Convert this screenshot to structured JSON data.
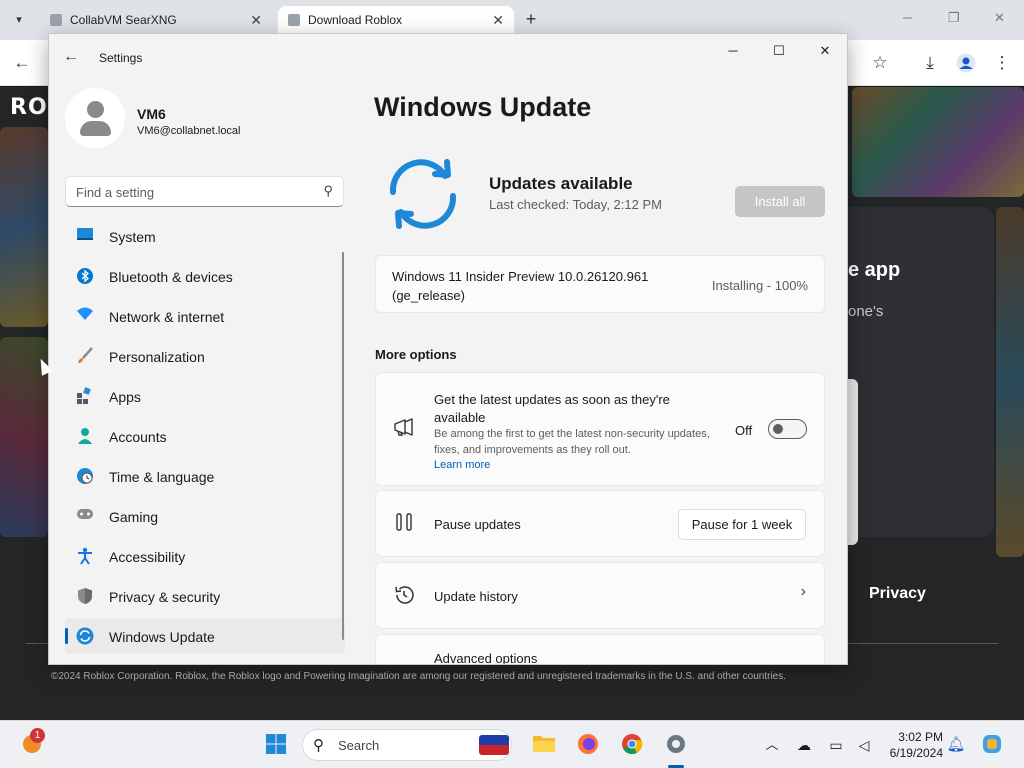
{
  "browser": {
    "tabs": [
      {
        "label": "CollabVM SearXNG"
      },
      {
        "label": "Download Roblox"
      }
    ],
    "close_glyph": "✕",
    "new_tab_glyph": "+"
  },
  "roblox_page": {
    "logo": "RO",
    "heading_fragment": "e app",
    "sub_fragment": "one's",
    "privacy_link": "Privacy",
    "footer": "©2024 Roblox Corporation. Roblox, the Roblox logo and Powering Imagination are among our registered and unregistered trademarks in the U.S. and other countries."
  },
  "settings": {
    "app_title": "Settings",
    "account": {
      "name": "VM6",
      "email": "VM6@collabnet.local"
    },
    "search": {
      "placeholder": "Find a setting"
    },
    "nav": [
      {
        "label": "System",
        "icon": "system-icon",
        "color": "#0078d4"
      },
      {
        "label": "Bluetooth & devices",
        "icon": "bluetooth-icon",
        "color": "#0078d4"
      },
      {
        "label": "Network & internet",
        "icon": "wifi-icon",
        "color": "#0a84ff"
      },
      {
        "label": "Personalization",
        "icon": "brush-icon",
        "color": "#d35400"
      },
      {
        "label": "Apps",
        "icon": "apps-icon",
        "color": "#4a6f8f"
      },
      {
        "label": "Accounts",
        "icon": "accounts-icon",
        "color": "#0f9d8a"
      },
      {
        "label": "Time & language",
        "icon": "globe-clock-icon",
        "color": "#0078d4"
      },
      {
        "label": "Gaming",
        "icon": "gamepad-icon",
        "color": "#6b6b6b"
      },
      {
        "label": "Accessibility",
        "icon": "accessibility-icon",
        "color": "#1a73e8"
      },
      {
        "label": "Privacy & security",
        "icon": "shield-icon",
        "color": "#6b6b6b"
      },
      {
        "label": "Windows Update",
        "icon": "windows-update-icon",
        "color": "#0a6ed1",
        "active": true
      }
    ],
    "main": {
      "title": "Windows Update",
      "status": "Updates available",
      "last_checked": "Last checked: Today, 2:12 PM",
      "install_button": "Install all",
      "update": {
        "name": "Windows 11 Insider Preview 10.0.26120.961 (ge_release)",
        "progress": "Installing - 100%"
      },
      "more_options_label": "More options",
      "latest": {
        "title": "Get the latest updates as soon as they're available",
        "description": "Be among the first to get the latest non-security updates, fixes, and improvements as they roll out.",
        "link": "Learn more",
        "toggle_label": "Off",
        "toggle_on": false
      },
      "pause": {
        "title": "Pause updates",
        "button": "Pause for 1 week"
      },
      "history": {
        "title": "Update history"
      },
      "advanced": {
        "title": "Advanced options"
      }
    }
  },
  "taskbar": {
    "notification_count": "1",
    "search_label": "Search",
    "time": "3:02 PM",
    "date": "6/19/2024"
  },
  "colors": {
    "accent": "#005fb8",
    "install_disabled": "#c5c5c5"
  }
}
